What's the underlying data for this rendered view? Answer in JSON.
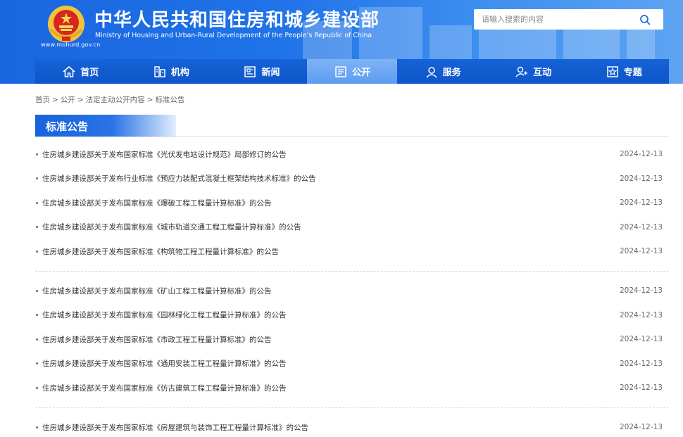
{
  "header": {
    "title_cn": "中华人民共和国住房和城乡建设部",
    "title_en": "Ministry of Housing and Urban-Rural Development of the People’s Republic of China",
    "site_url": "www.mohurd.gov.cn",
    "search_placeholder": "请输入搜索的内容"
  },
  "nav": {
    "items": [
      {
        "label": "首页",
        "icon": "home-icon"
      },
      {
        "label": "机构",
        "icon": "org-icon"
      },
      {
        "label": "新闻",
        "icon": "news-icon"
      },
      {
        "label": "公开",
        "icon": "public-icon",
        "active": true
      },
      {
        "label": "服务",
        "icon": "service-icon"
      },
      {
        "label": "互动",
        "icon": "interact-icon"
      },
      {
        "label": "专题",
        "icon": "topic-icon"
      }
    ]
  },
  "breadcrumb": {
    "items": [
      "首页",
      "公开",
      "法定主动公开内容",
      "标准公告"
    ],
    "separator": ">"
  },
  "section": {
    "title": "标准公告"
  },
  "groups": [
    [
      {
        "title": "住房城乡建设部关于发布国家标准《光伏发电站设计规范》局部修订的公告",
        "date": "2024-12-13"
      },
      {
        "title": "住房城乡建设部关于发布行业标准《预应力装配式混凝土框架结构技术标准》的公告",
        "date": "2024-12-13"
      },
      {
        "title": "住房城乡建设部关于发布国家标准《爆破工程工程量计算标准》的公告",
        "date": "2024-12-13"
      },
      {
        "title": "住房城乡建设部关于发布国家标准《城市轨道交通工程工程量计算标准》的公告",
        "date": "2024-12-13"
      },
      {
        "title": "住房城乡建设部关于发布国家标准《构筑物工程工程量计算标准》的公告",
        "date": "2024-12-13"
      }
    ],
    [
      {
        "title": "住房城乡建设部关于发布国家标准《矿山工程工程量计算标准》的公告",
        "date": "2024-12-13"
      },
      {
        "title": "住房城乡建设部关于发布国家标准《园林绿化工程工程量计算标准》的公告",
        "date": "2024-12-13"
      },
      {
        "title": "住房城乡建设部关于发布国家标准《市政工程工程量计算标准》的公告",
        "date": "2024-12-13"
      },
      {
        "title": "住房城乡建设部关于发布国家标准《通用安装工程工程量计算标准》的公告",
        "date": "2024-12-13"
      },
      {
        "title": "住房城乡建设部关于发布国家标准《仿古建筑工程工程量计算标准》的公告",
        "date": "2024-12-13"
      }
    ],
    [
      {
        "title": "住房城乡建设部关于发布国家标准《房屋建筑与装饰工程工程量计算标准》的公告",
        "date": "2024-12-13"
      }
    ]
  ],
  "colors": {
    "header_blue": "#1a66e0",
    "nav_blue": "#1662d8",
    "nav_active": "#6aa6f2",
    "bullet": "#3a70c8"
  }
}
